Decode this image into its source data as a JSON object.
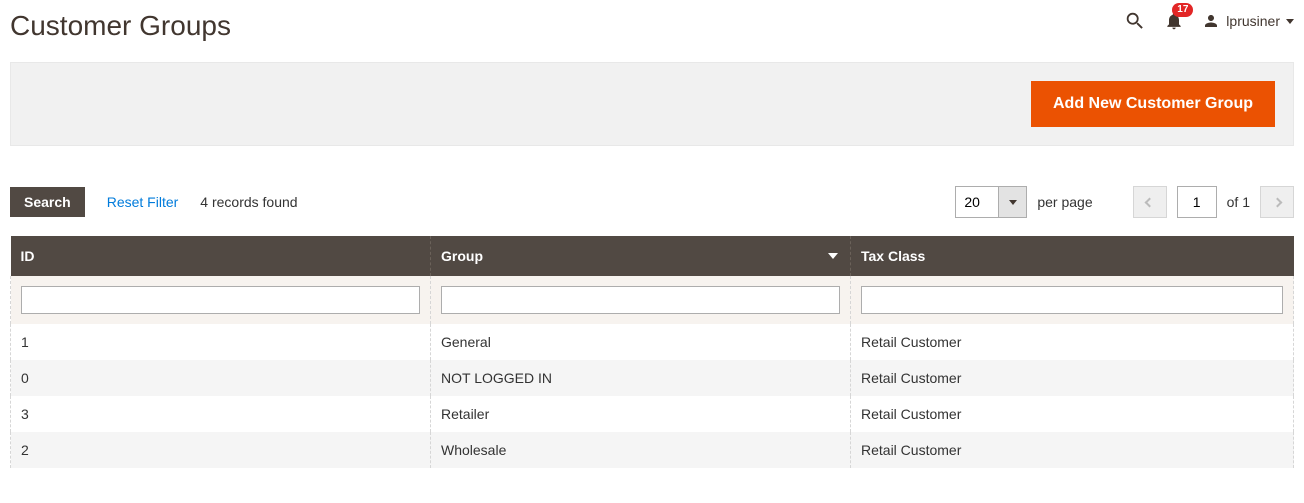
{
  "header": {
    "title": "Customer Groups",
    "notification_count": "17",
    "username": "lprusiner"
  },
  "actions": {
    "add_button": "Add New Customer Group"
  },
  "toolbar": {
    "search_label": "Search",
    "reset_label": "Reset Filter",
    "records_found": "4 records found",
    "per_page_value": "20",
    "per_page_label": "per page",
    "current_page": "1",
    "of_label": "of",
    "total_pages": "1"
  },
  "table": {
    "columns": {
      "id": "ID",
      "group": "Group",
      "tax_class": "Tax Class"
    },
    "rows": [
      {
        "id": "1",
        "group": "General",
        "tax_class": "Retail Customer"
      },
      {
        "id": "0",
        "group": "NOT LOGGED IN",
        "tax_class": "Retail Customer"
      },
      {
        "id": "3",
        "group": "Retailer",
        "tax_class": "Retail Customer"
      },
      {
        "id": "2",
        "group": "Wholesale",
        "tax_class": "Retail Customer"
      }
    ]
  }
}
